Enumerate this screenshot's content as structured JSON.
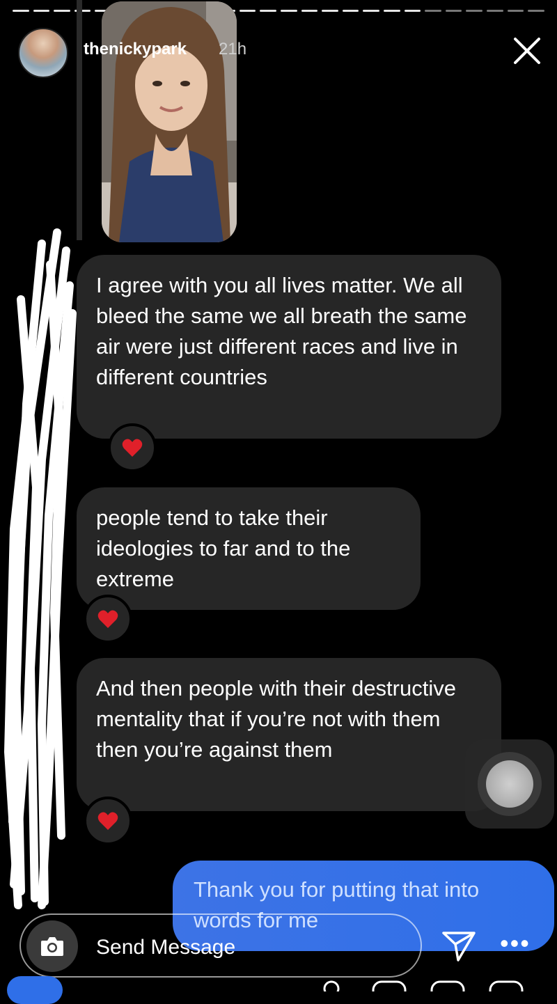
{
  "header": {
    "username": "thenickypark",
    "time": "21h"
  },
  "messages": [
    {
      "text": "I agree with you all lives matter. We all bleed the same we all breath the same air were just different races and live in different countries",
      "reaction": "heart-icon"
    },
    {
      "text": "people tend to take their ideologies to far and to the extreme",
      "reaction": "heart-icon"
    },
    {
      "text": "And then people with their destructive mentality that if you’re not with them then you’re against them",
      "reaction": "heart-icon"
    }
  ],
  "sent": {
    "text": "Thank you for putting that into words for me"
  },
  "composer": {
    "placeholder": "Send Message",
    "more": "•••"
  },
  "colors": {
    "bubble": "#262626",
    "sent": "#2f6fe8",
    "reaction": "#e0202a"
  }
}
